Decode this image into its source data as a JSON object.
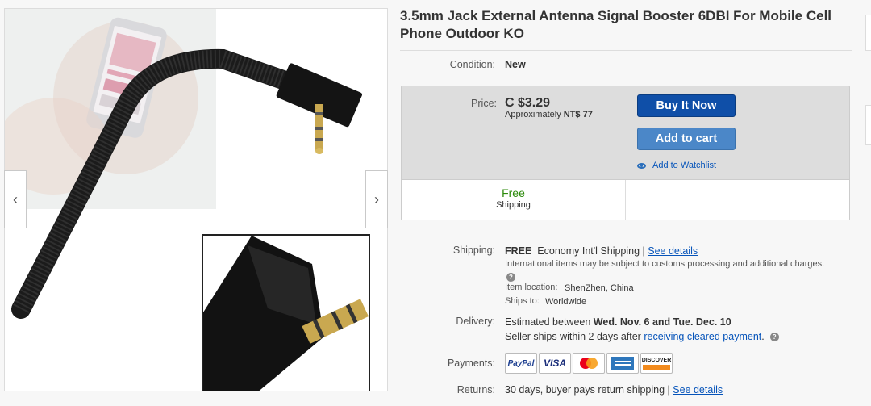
{
  "product": {
    "title": "3.5mm Jack External Antenna Signal Booster 6DBI For Mobile Cell Phone Outdoor KO"
  },
  "gallery": {
    "prev_icon": "chevron-left-icon",
    "next_icon": "chevron-right-icon",
    "prev_glyph": "‹",
    "next_glyph": "›"
  },
  "condition": {
    "label": "Condition:",
    "value": "New"
  },
  "price": {
    "label": "Price:",
    "value": "C $3.29",
    "approx_prefix": "Approximately",
    "approx_value": "NT$ 77"
  },
  "actions": {
    "buy_now": "Buy It Now",
    "add_to_cart": "Add to cart",
    "watchlist": "Add to Watchlist",
    "buy_color": "#0f4fa8",
    "cart_color": "#4b87c8"
  },
  "free_shipping": {
    "title": "Free",
    "subtitle": "Shipping",
    "color": "#2b8a0a"
  },
  "shipping": {
    "label": "Shipping:",
    "free": "FREE",
    "service": "Economy Int'l Shipping |",
    "details_link": "See details",
    "note": "International items may be subject to customs processing and additional charges.",
    "location_label": "Item location:",
    "location": "ShenZhen, China",
    "ships_to_label": "Ships to:",
    "ships_to": "Worldwide"
  },
  "delivery": {
    "label": "Delivery:",
    "estimate_prefix": "Estimated between",
    "estimate_dates": "Wed. Nov. 6 and Tue. Dec. 10",
    "seller_prefix": "Seller ships within 2 days after",
    "payment_link": "receiving cleared payment",
    "seller_suffix": "."
  },
  "payments": {
    "label": "Payments:",
    "methods": [
      "PayPal",
      "VISA",
      "Mastercard",
      "American Express",
      "DISCOVER"
    ]
  },
  "returns": {
    "label": "Returns:",
    "policy": "30 days, buyer pays return shipping |",
    "details_link": "See details"
  }
}
